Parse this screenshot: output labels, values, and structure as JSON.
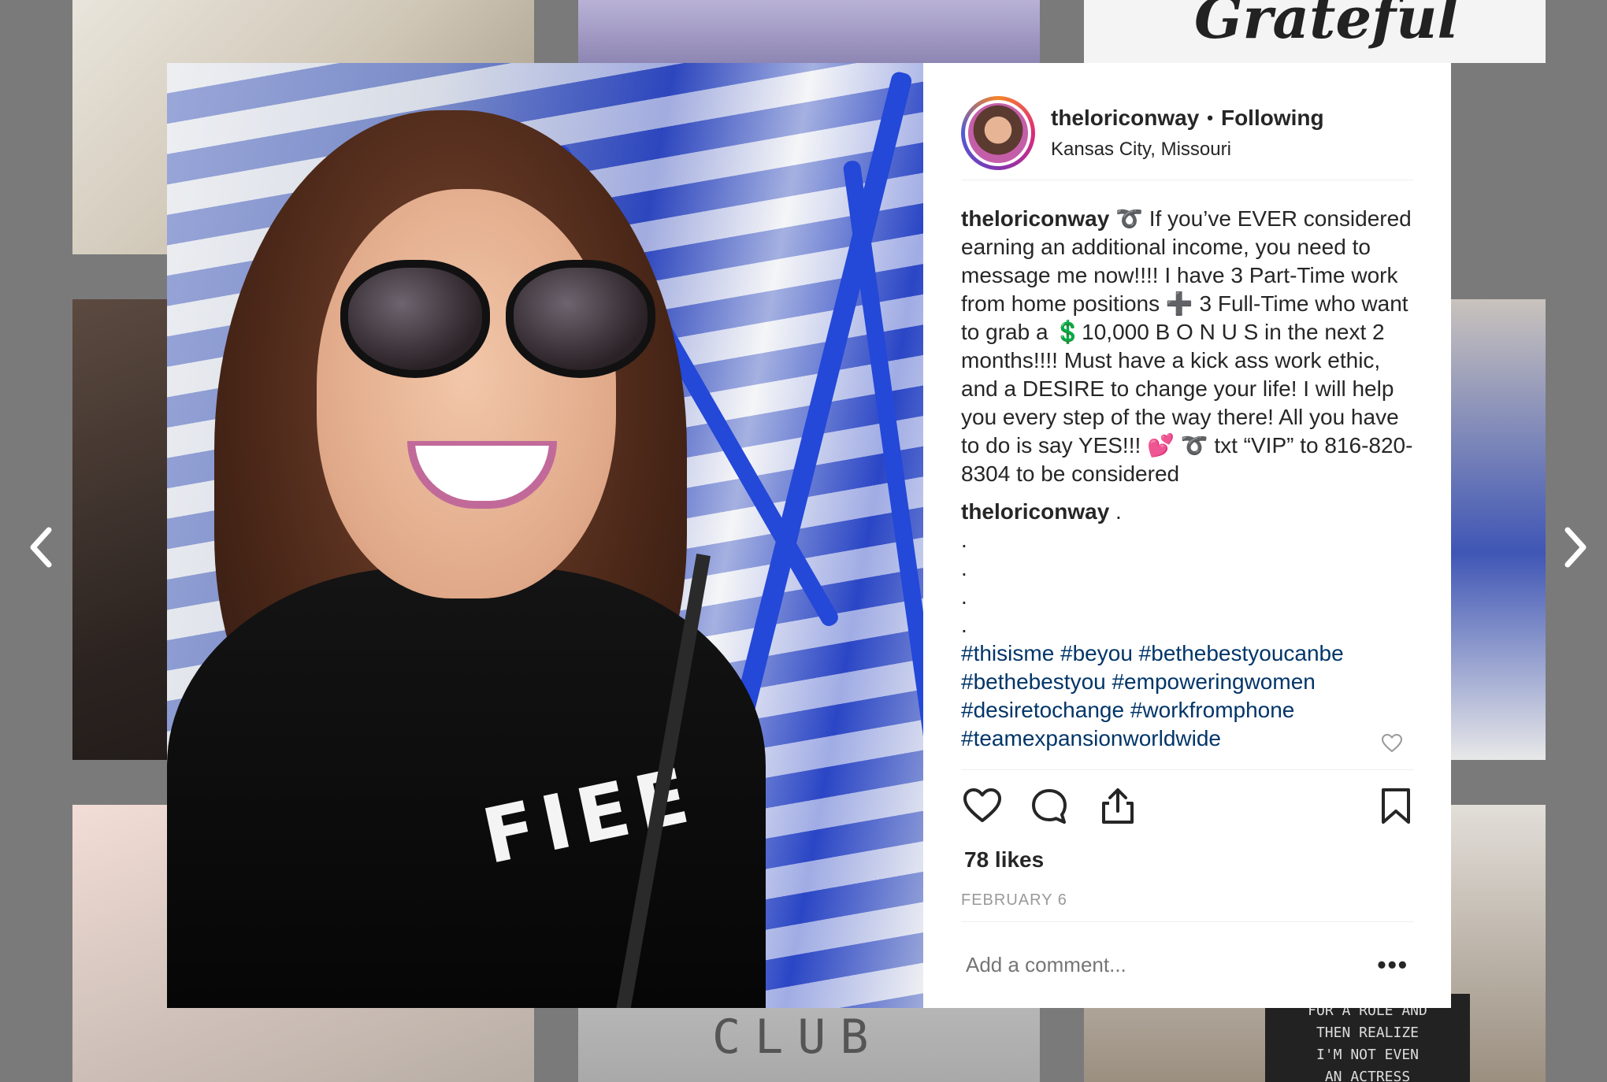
{
  "background": {
    "tile_grateful": "Grateful",
    "tile_club": "CLUB",
    "letterboard_lines": [
      "FOR A ROLE AND",
      "THEN REALIZE",
      "I'M NOT EVEN",
      "AN ACTRESS"
    ]
  },
  "navigation": {
    "prev_icon": "chevron-left-icon",
    "next_icon": "chevron-right-icon"
  },
  "post": {
    "photo_shirt_text": "FIEE",
    "header": {
      "username": "theloriconway",
      "separator": "•",
      "follow_status": "Following",
      "location": "Kansas City, Missouri"
    },
    "caption": {
      "username": "theloriconway",
      "text": "➰ If you’ve EVER considered earning an additional income, you need to message me now!!!! I have 3 Part-Time work from home positions ➕ 3 Full-Time who want to grab a 💲10,000 B O N U S in the next 2 months!!!! Must have a kick ass work ethic, and a DESIRE to change your life! I will help you every step of the way there! All you have to do is say YES!!! 💕 ➰ txt “VIP” to 816-820-8304 to be considered"
    },
    "comment": {
      "username": "theloriconway",
      "text": ".",
      "dots": [
        ".",
        ".",
        ".",
        "."
      ],
      "hashtags": "#thisisme #beyou #bethebestyoucanbe #bethebestyou #empoweringwomen #desiretochange #workfromphone #teamexpansionworldwide"
    },
    "likes": "78 likes",
    "date": "FEBRUARY 6",
    "comment_placeholder": "Add a comment...",
    "more_label": "•••",
    "colors": {
      "link": "#003569",
      "text": "#262626",
      "muted": "#999999"
    }
  }
}
